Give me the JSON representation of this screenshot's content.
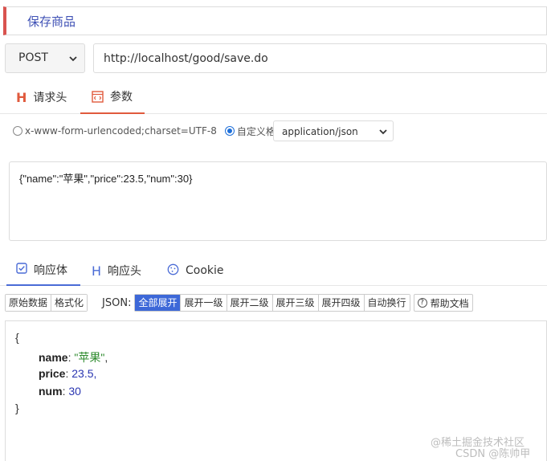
{
  "request": {
    "name": "保存商品",
    "method": "POST",
    "url": "http://localhost/good/save.do"
  },
  "request_tabs": [
    {
      "label": "请求头",
      "icon": "header-h-icon"
    },
    {
      "label": "参数",
      "icon": "code-file-icon",
      "active": true
    }
  ],
  "body_options": {
    "urlencoded_label": "x-www-form-urlencoded;charset=UTF-8",
    "custom_label": "自定义格式",
    "selected": "custom",
    "content_type": "application/json"
  },
  "body_text": "{\"name\":\"苹果\",\"price\":23.5,\"num\":30}",
  "response_tabs": [
    {
      "label": "响应体",
      "icon": "checkbox-icon",
      "active": true
    },
    {
      "label": "响应头",
      "icon": "header-h-icon"
    },
    {
      "label": "Cookie",
      "icon": "cookie-icon"
    }
  ],
  "toolbar": {
    "raw": "原始数据",
    "format": "格式化",
    "json_label": "JSON:",
    "expand_buttons": [
      "全部展开",
      "展开一级",
      "展开二级",
      "展开三级",
      "展开四级",
      "自动换行"
    ],
    "active_expand": "全部展开",
    "help": "帮助文档"
  },
  "response_json": {
    "open_brace": "{",
    "close_brace": "}",
    "fields": [
      {
        "key": "name",
        "value": "\"苹果\"",
        "type": "string",
        "suffix": ","
      },
      {
        "key": "price",
        "value": "23.5",
        "type": "number",
        "suffix": ","
      },
      {
        "key": "num",
        "value": "30",
        "type": "number",
        "suffix": ""
      }
    ]
  },
  "watermarks": {
    "site": "@稀土掘金技术社区",
    "author": "CSDN @陈帅甲"
  },
  "colors": {
    "accent_red": "#e05a3d",
    "accent_blue": "#3d68d8",
    "string_green": "#2c8a2c",
    "number_blue": "#2a36b1"
  }
}
